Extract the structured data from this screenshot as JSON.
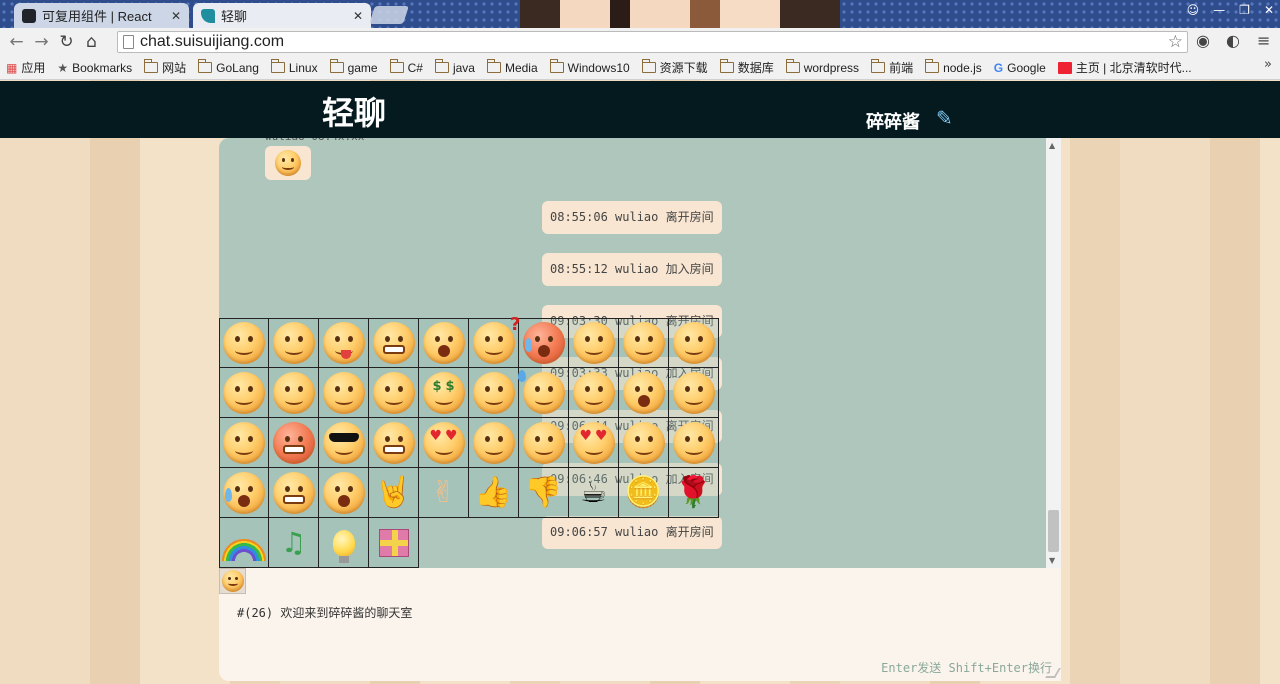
{
  "browser": {
    "tabs": [
      {
        "title": "可复用组件 | React",
        "active": false,
        "favicon_color": "#20232a"
      },
      {
        "title": "轻聊",
        "active": true,
        "favicon_color": "#1f8fa0"
      }
    ],
    "url": "chat.suisuijiang.com",
    "bookmarks": [
      {
        "label": "应用",
        "icon": "apps-grid-icon"
      },
      {
        "label": "Bookmarks",
        "icon": "star-icon"
      },
      {
        "label": "网站",
        "icon": "folder-icon"
      },
      {
        "label": "GoLang",
        "icon": "folder-icon"
      },
      {
        "label": "Linux",
        "icon": "folder-icon"
      },
      {
        "label": "game",
        "icon": "folder-icon"
      },
      {
        "label": "C#",
        "icon": "folder-icon"
      },
      {
        "label": "java",
        "icon": "folder-icon"
      },
      {
        "label": "Media",
        "icon": "folder-icon"
      },
      {
        "label": "Windows10",
        "icon": "folder-icon"
      },
      {
        "label": "资源下载",
        "icon": "folder-icon"
      },
      {
        "label": "数据库",
        "icon": "folder-icon"
      },
      {
        "label": "wordpress",
        "icon": "folder-icon"
      },
      {
        "label": "前端",
        "icon": "folder-icon"
      },
      {
        "label": "node.js",
        "icon": "folder-icon"
      },
      {
        "label": "Google",
        "icon": "google-icon"
      },
      {
        "label": "主页 | 北京清软时代...",
        "icon": "calendar-icon"
      }
    ],
    "bookmarks_more": "»"
  },
  "site": {
    "title": "轻聊",
    "room_name": "碎碎酱"
  },
  "messages": [
    {
      "kind": "emoji"
    },
    {
      "kind": "system",
      "text": "08:55:06 wuliao 离开房间"
    },
    {
      "kind": "system",
      "text": "08:55:12 wuliao 加入房间"
    },
    {
      "kind": "system",
      "text": "09:03:30 wuliao 离开房间"
    },
    {
      "kind": "system",
      "text": "09:03:33 wuliao 加入房间"
    },
    {
      "kind": "system",
      "text": "09:06:44 wuliao 离开房间"
    },
    {
      "kind": "system",
      "text": "09:06:46 wuliao 加入房间"
    },
    {
      "kind": "system",
      "text": "09:06:57 wuliao 离开房间"
    }
  ],
  "input": {
    "draft": "#(26) 欢迎来到碎碎酱的聊天室",
    "hint": "Enter发送 Shift+Enter换行"
  },
  "emoji_picker": {
    "items": [
      "smile",
      "shy",
      "tongue",
      "grimace",
      "surprised",
      "question",
      "angry-cry",
      "dazed",
      "vomit",
      "smug",
      "cover-face",
      "hiding",
      "grin",
      "thinking",
      "money",
      "wink",
      "sweat",
      "sleepy",
      "shocked",
      "sad",
      "yawn",
      "red-angry",
      "cool",
      "furious",
      "love-smile",
      "laughing",
      "happy",
      "kiss",
      "smirk",
      "proud",
      "crying",
      "scared",
      "wailing",
      "rock-hand",
      "victory-hand",
      "thumbs-up",
      "thumbs-down",
      "coffee",
      "coins",
      "rose",
      "rainbow",
      "music",
      "bulb",
      "gift"
    ]
  }
}
